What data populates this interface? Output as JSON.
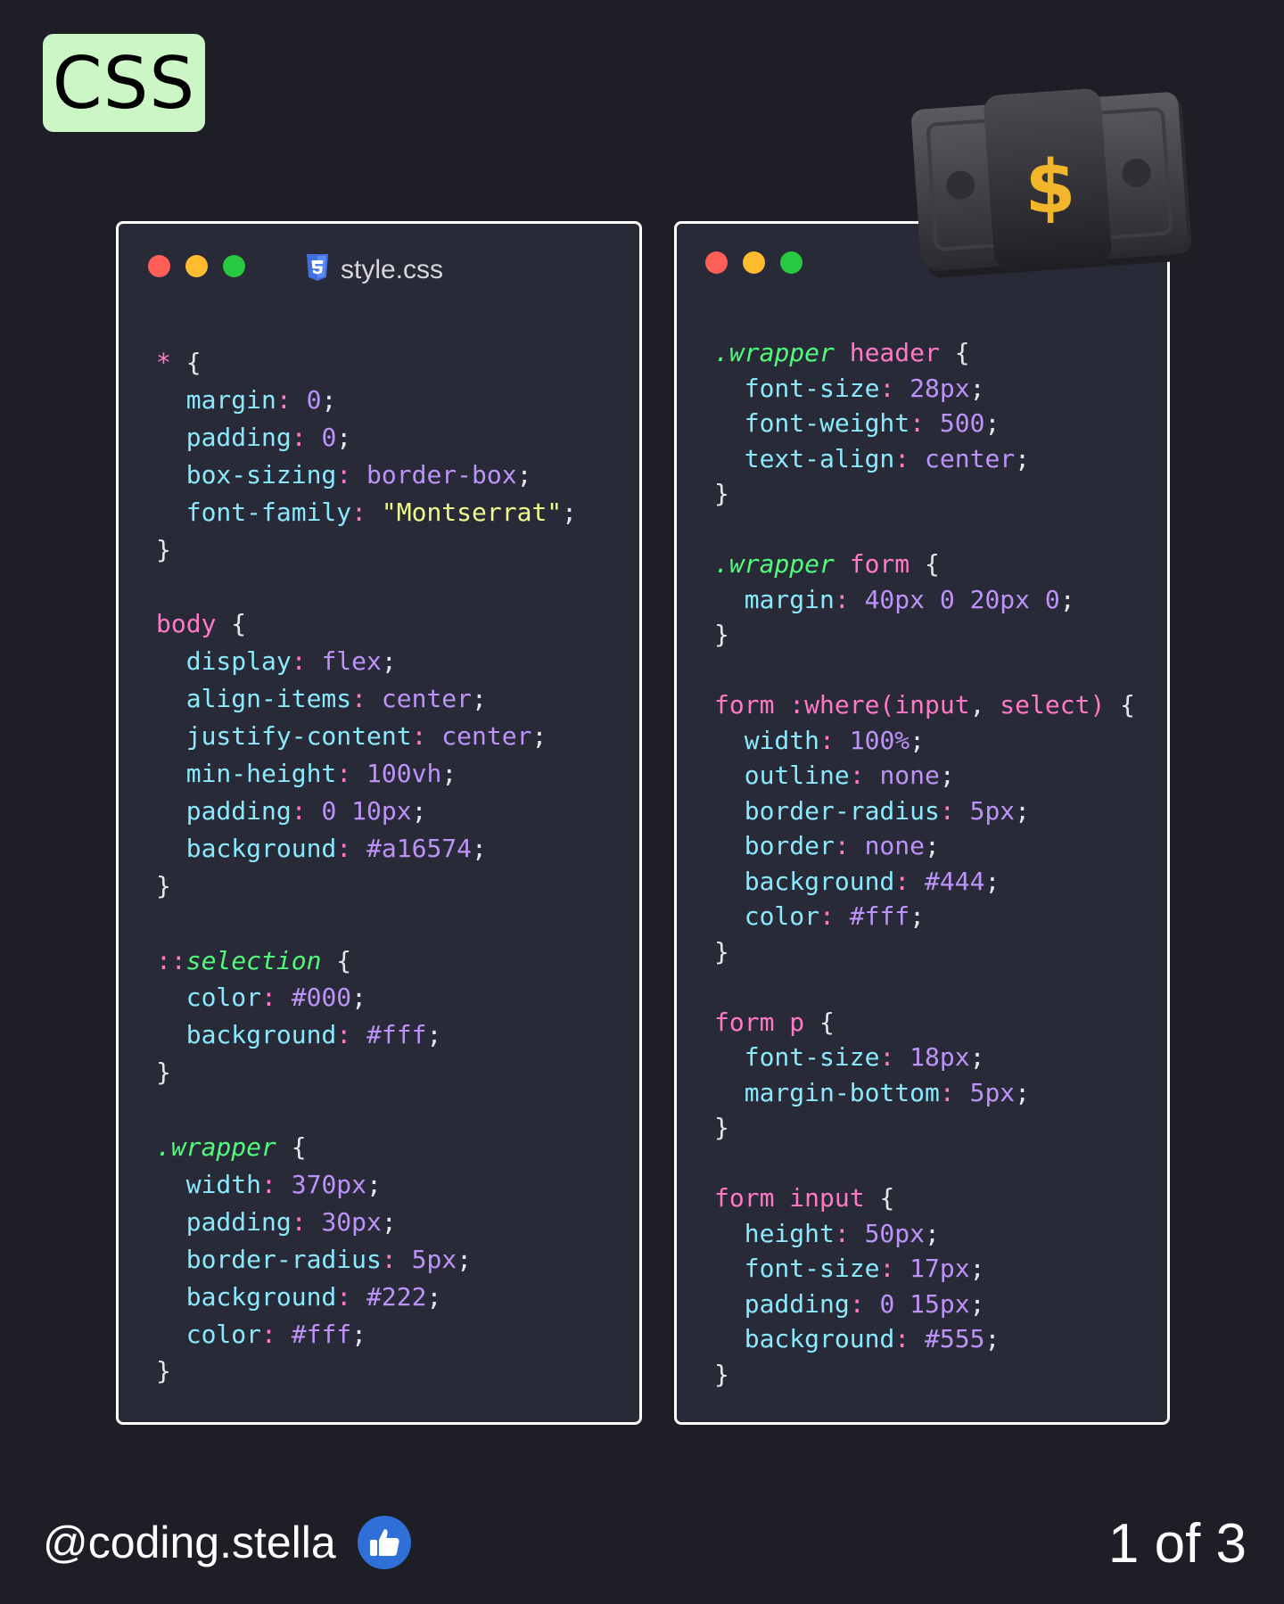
{
  "badge": {
    "label": "CSS"
  },
  "left_editor": {
    "tab_label": "style.css",
    "tab_icon": "css3-icon",
    "lines": [
      [
        {
          "t": "* ",
          "c": "star"
        },
        {
          "t": "{",
          "c": "plain"
        }
      ],
      [
        {
          "t": "  margin",
          "c": "prop"
        },
        {
          "t": ": ",
          "c": "punc"
        },
        {
          "t": "0",
          "c": "num"
        },
        {
          "t": ";",
          "c": "plain"
        }
      ],
      [
        {
          "t": "  padding",
          "c": "prop"
        },
        {
          "t": ": ",
          "c": "punc"
        },
        {
          "t": "0",
          "c": "num"
        },
        {
          "t": ";",
          "c": "plain"
        }
      ],
      [
        {
          "t": "  box-sizing",
          "c": "prop"
        },
        {
          "t": ": ",
          "c": "punc"
        },
        {
          "t": "border-box",
          "c": "kw"
        },
        {
          "t": ";",
          "c": "plain"
        }
      ],
      [
        {
          "t": "  font-family",
          "c": "prop"
        },
        {
          "t": ": ",
          "c": "punc"
        },
        {
          "t": "\"Montserrat\"",
          "c": "str"
        },
        {
          "t": ";",
          "c": "plain"
        }
      ],
      [
        {
          "t": "}",
          "c": "plain"
        }
      ],
      [],
      [
        {
          "t": "body ",
          "c": "sel"
        },
        {
          "t": "{",
          "c": "plain"
        }
      ],
      [
        {
          "t": "  display",
          "c": "prop"
        },
        {
          "t": ": ",
          "c": "punc"
        },
        {
          "t": "flex",
          "c": "kw"
        },
        {
          "t": ";",
          "c": "plain"
        }
      ],
      [
        {
          "t": "  align-items",
          "c": "prop"
        },
        {
          "t": ": ",
          "c": "punc"
        },
        {
          "t": "center",
          "c": "kw"
        },
        {
          "t": ";",
          "c": "plain"
        }
      ],
      [
        {
          "t": "  justify-content",
          "c": "prop"
        },
        {
          "t": ": ",
          "c": "punc"
        },
        {
          "t": "center",
          "c": "kw"
        },
        {
          "t": ";",
          "c": "plain"
        }
      ],
      [
        {
          "t": "  min-height",
          "c": "prop"
        },
        {
          "t": ": ",
          "c": "punc"
        },
        {
          "t": "100vh",
          "c": "num"
        },
        {
          "t": ";",
          "c": "plain"
        }
      ],
      [
        {
          "t": "  padding",
          "c": "prop"
        },
        {
          "t": ": ",
          "c": "punc"
        },
        {
          "t": "0 10px",
          "c": "num"
        },
        {
          "t": ";",
          "c": "plain"
        }
      ],
      [
        {
          "t": "  background",
          "c": "prop"
        },
        {
          "t": ": ",
          "c": "punc"
        },
        {
          "t": "#a16574",
          "c": "num"
        },
        {
          "t": ";",
          "c": "plain"
        }
      ],
      [
        {
          "t": "}",
          "c": "plain"
        }
      ],
      [],
      [
        {
          "t": "::",
          "c": "sel"
        },
        {
          "t": "selection",
          "c": "cls"
        },
        {
          "t": " {",
          "c": "plain"
        }
      ],
      [
        {
          "t": "  color",
          "c": "prop"
        },
        {
          "t": ": ",
          "c": "punc"
        },
        {
          "t": "#000",
          "c": "num"
        },
        {
          "t": ";",
          "c": "plain"
        }
      ],
      [
        {
          "t": "  background",
          "c": "prop"
        },
        {
          "t": ": ",
          "c": "punc"
        },
        {
          "t": "#fff",
          "c": "num"
        },
        {
          "t": ";",
          "c": "plain"
        }
      ],
      [
        {
          "t": "}",
          "c": "plain"
        }
      ],
      [],
      [
        {
          "t": ".wrapper",
          "c": "cls"
        },
        {
          "t": " {",
          "c": "plain"
        }
      ],
      [
        {
          "t": "  width",
          "c": "prop"
        },
        {
          "t": ": ",
          "c": "punc"
        },
        {
          "t": "370px",
          "c": "num"
        },
        {
          "t": ";",
          "c": "plain"
        }
      ],
      [
        {
          "t": "  padding",
          "c": "prop"
        },
        {
          "t": ": ",
          "c": "punc"
        },
        {
          "t": "30px",
          "c": "num"
        },
        {
          "t": ";",
          "c": "plain"
        }
      ],
      [
        {
          "t": "  border-radius",
          "c": "prop"
        },
        {
          "t": ": ",
          "c": "punc"
        },
        {
          "t": "5px",
          "c": "num"
        },
        {
          "t": ";",
          "c": "plain"
        }
      ],
      [
        {
          "t": "  background",
          "c": "prop"
        },
        {
          "t": ": ",
          "c": "punc"
        },
        {
          "t": "#222",
          "c": "num"
        },
        {
          "t": ";",
          "c": "plain"
        }
      ],
      [
        {
          "t": "  color",
          "c": "prop"
        },
        {
          "t": ": ",
          "c": "punc"
        },
        {
          "t": "#fff",
          "c": "num"
        },
        {
          "t": ";",
          "c": "plain"
        }
      ],
      [
        {
          "t": "}",
          "c": "plain"
        }
      ]
    ]
  },
  "right_editor": {
    "lines": [
      [
        {
          "t": ".wrapper",
          "c": "cls"
        },
        {
          "t": " header ",
          "c": "sel"
        },
        {
          "t": "{",
          "c": "plain"
        }
      ],
      [
        {
          "t": "  font-size",
          "c": "prop"
        },
        {
          "t": ": ",
          "c": "punc"
        },
        {
          "t": "28px",
          "c": "num"
        },
        {
          "t": ";",
          "c": "plain"
        }
      ],
      [
        {
          "t": "  font-weight",
          "c": "prop"
        },
        {
          "t": ": ",
          "c": "punc"
        },
        {
          "t": "500",
          "c": "num"
        },
        {
          "t": ";",
          "c": "plain"
        }
      ],
      [
        {
          "t": "  text-align",
          "c": "prop"
        },
        {
          "t": ": ",
          "c": "punc"
        },
        {
          "t": "center",
          "c": "kw"
        },
        {
          "t": ";",
          "c": "plain"
        }
      ],
      [
        {
          "t": "}",
          "c": "plain"
        }
      ],
      [],
      [
        {
          "t": ".wrapper",
          "c": "cls"
        },
        {
          "t": " form ",
          "c": "sel"
        },
        {
          "t": "{",
          "c": "plain"
        }
      ],
      [
        {
          "t": "  margin",
          "c": "prop"
        },
        {
          "t": ": ",
          "c": "punc"
        },
        {
          "t": "40px 0 20px 0",
          "c": "num"
        },
        {
          "t": ";",
          "c": "plain"
        }
      ],
      [
        {
          "t": "}",
          "c": "plain"
        }
      ],
      [],
      [
        {
          "t": "form :where(input",
          "c": "sel"
        },
        {
          "t": ", ",
          "c": "plain"
        },
        {
          "t": "select) ",
          "c": "sel"
        },
        {
          "t": "{",
          "c": "plain"
        }
      ],
      [
        {
          "t": "  width",
          "c": "prop"
        },
        {
          "t": ": ",
          "c": "punc"
        },
        {
          "t": "100%",
          "c": "num"
        },
        {
          "t": ";",
          "c": "plain"
        }
      ],
      [
        {
          "t": "  outline",
          "c": "prop"
        },
        {
          "t": ": ",
          "c": "punc"
        },
        {
          "t": "none",
          "c": "kw"
        },
        {
          "t": ";",
          "c": "plain"
        }
      ],
      [
        {
          "t": "  border-radius",
          "c": "prop"
        },
        {
          "t": ": ",
          "c": "punc"
        },
        {
          "t": "5px",
          "c": "num"
        },
        {
          "t": ";",
          "c": "plain"
        }
      ],
      [
        {
          "t": "  border",
          "c": "prop"
        },
        {
          "t": ": ",
          "c": "punc"
        },
        {
          "t": "none",
          "c": "kw"
        },
        {
          "t": ";",
          "c": "plain"
        }
      ],
      [
        {
          "t": "  background",
          "c": "prop"
        },
        {
          "t": ": ",
          "c": "punc"
        },
        {
          "t": "#444",
          "c": "num"
        },
        {
          "t": ";",
          "c": "plain"
        }
      ],
      [
        {
          "t": "  color",
          "c": "prop"
        },
        {
          "t": ": ",
          "c": "punc"
        },
        {
          "t": "#fff",
          "c": "num"
        },
        {
          "t": ";",
          "c": "plain"
        }
      ],
      [
        {
          "t": "}",
          "c": "plain"
        }
      ],
      [],
      [
        {
          "t": "form p ",
          "c": "sel"
        },
        {
          "t": "{",
          "c": "plain"
        }
      ],
      [
        {
          "t": "  font-size",
          "c": "prop"
        },
        {
          "t": ": ",
          "c": "punc"
        },
        {
          "t": "18px",
          "c": "num"
        },
        {
          "t": ";",
          "c": "plain"
        }
      ],
      [
        {
          "t": "  margin-bottom",
          "c": "prop"
        },
        {
          "t": ": ",
          "c": "punc"
        },
        {
          "t": "5px",
          "c": "num"
        },
        {
          "t": ";",
          "c": "plain"
        }
      ],
      [
        {
          "t": "}",
          "c": "plain"
        }
      ],
      [],
      [
        {
          "t": "form input ",
          "c": "sel"
        },
        {
          "t": "{",
          "c": "plain"
        }
      ],
      [
        {
          "t": "  height",
          "c": "prop"
        },
        {
          "t": ": ",
          "c": "punc"
        },
        {
          "t": "50px",
          "c": "num"
        },
        {
          "t": ";",
          "c": "plain"
        }
      ],
      [
        {
          "t": "  font-size",
          "c": "prop"
        },
        {
          "t": ": ",
          "c": "punc"
        },
        {
          "t": "17px",
          "c": "num"
        },
        {
          "t": ";",
          "c": "plain"
        }
      ],
      [
        {
          "t": "  padding",
          "c": "prop"
        },
        {
          "t": ": ",
          "c": "punc"
        },
        {
          "t": "0 15px",
          "c": "num"
        },
        {
          "t": ";",
          "c": "plain"
        }
      ],
      [
        {
          "t": "  background",
          "c": "prop"
        },
        {
          "t": ": ",
          "c": "punc"
        },
        {
          "t": "#555",
          "c": "num"
        },
        {
          "t": ";",
          "c": "plain"
        }
      ],
      [
        {
          "t": "}",
          "c": "plain"
        }
      ]
    ]
  },
  "decoration": {
    "icon": "money-stack-icon",
    "symbol": "$"
  },
  "footer": {
    "handle": "@coding.stella",
    "verified_icon": "thumbs-up-icon",
    "page_indicator": "1 of 3"
  },
  "colors": {
    "background": "#1d1e26",
    "editor_bg": "#292a38",
    "badge_bg": "#ccf6c5",
    "selector": "#ff79c6",
    "class": "#50fa7b",
    "property": "#8be9fd",
    "value": "#bd93f9",
    "string": "#f1fa8c"
  }
}
